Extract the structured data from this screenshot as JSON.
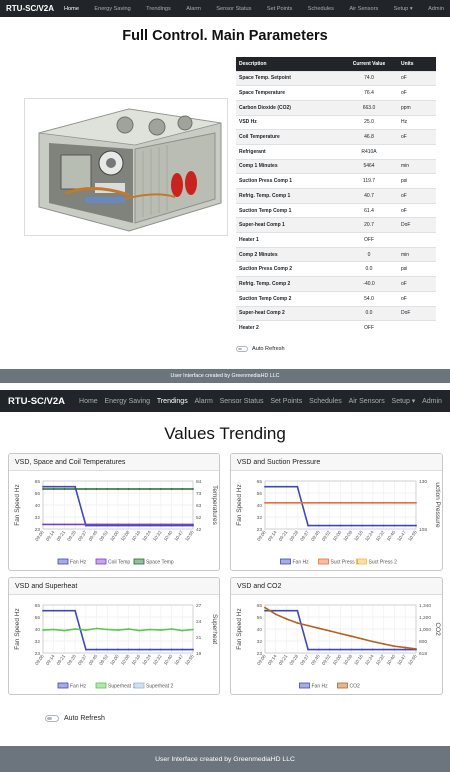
{
  "brand": "RTU-SC/V2A",
  "nav": [
    {
      "label": "Home"
    },
    {
      "label": "Energy Saving"
    },
    {
      "label": "Trendings"
    },
    {
      "label": "Alarm"
    },
    {
      "label": "Sensor Status"
    },
    {
      "label": "Set Points"
    },
    {
      "label": "Schedules"
    },
    {
      "label": "Air Sensors"
    },
    {
      "label": "Setup ▾"
    },
    {
      "label": "Admin"
    }
  ],
  "page1": {
    "title": "Full Control. Main Parameters",
    "table_headers": [
      "Description",
      "Current Value",
      "Units"
    ],
    "rows": [
      [
        "Space Temp. Setpoint",
        "74.0",
        "oF"
      ],
      [
        "Space Temperature",
        "76.4",
        "oF"
      ],
      [
        "Carbon Dioxide (CO2)",
        "663.0",
        "ppm"
      ],
      [
        "VSD Hz",
        "25.0",
        "Hz"
      ],
      [
        "Coil Temperature",
        "46.8",
        "oF"
      ],
      [
        "Refrigerant",
        "R410A",
        ""
      ],
      [
        "Comp 1 Minutes",
        "5464",
        "min"
      ],
      [
        "Suction Press Comp 1",
        "119.7",
        "psi"
      ],
      [
        "Refrig. Temp. Comp 1",
        "40.7",
        "oF"
      ],
      [
        "Suction Temp Comp 1",
        "61.4",
        "oF"
      ],
      [
        "Super-heat Comp 1",
        "20.7",
        "DoF"
      ],
      [
        "Heater 1",
        "OFF",
        ""
      ],
      [
        "Comp 2 Minutes",
        "0",
        "min"
      ],
      [
        "Suction Press Comp 2",
        "0.0",
        "psi"
      ],
      [
        "Refrig. Temp. Comp 2",
        "-40.0",
        "oF"
      ],
      [
        "Suction Temp Comp 2",
        "54.0",
        "oF"
      ],
      [
        "Super-heat Comp 2",
        "0.0",
        "DoF"
      ],
      [
        "Heater 2",
        "OFF",
        ""
      ]
    ],
    "auto_refresh": "Auto Refresh",
    "footer": "User Interface created by GreenmediaHD LLC"
  },
  "page2": {
    "title": "Values Trending",
    "auto_refresh": "Auto Refresh",
    "footer": "User Interface created by GreenmediaHD LLC"
  },
  "colors": {
    "fan": "#3f48b9",
    "coil": "#7a3fc8",
    "space": "#1f6b2f",
    "suct1": "#ef6e35",
    "suct2": "#f5b942",
    "sh1": "#58c74d",
    "sh2": "#9ab8d9",
    "co2": "#b4621c"
  },
  "chart_data": [
    {
      "type": "line",
      "title": "VSD, Space and Coil Temperatures",
      "ylabel": "Fan Speed Hz",
      "y2label": "Temperatures",
      "x": [
        "09:06",
        "09:14",
        "09:21",
        "09:28",
        "09:37",
        "09:45",
        "09:52",
        "10:00",
        "10:08",
        "10:16",
        "10:24",
        "10:32",
        "10:40",
        "10:47",
        "10:55"
      ],
      "yticks": [
        "65",
        "56",
        "40",
        "32",
        "23"
      ],
      "y2ticks": [
        "84",
        "73",
        "63",
        "52",
        "42"
      ],
      "ylim": [
        23,
        65
      ],
      "y2lim": [
        42,
        84
      ],
      "series": [
        {
          "name": "Fan Hz",
          "axis": "left",
          "color": "#3f48b9",
          "values": [
            60,
            60,
            60,
            60,
            26,
            26,
            26,
            26,
            26,
            26,
            26,
            26,
            26,
            26,
            26
          ]
        },
        {
          "name": "Coil Temp",
          "axis": "right",
          "color": "#7a3fc8",
          "values": [
            46,
            46,
            46,
            46,
            46,
            46,
            46,
            46,
            46,
            46,
            46,
            46,
            46,
            46,
            46
          ]
        },
        {
          "name": "Space Temp",
          "axis": "right",
          "color": "#1f6b2f",
          "values": [
            77,
            77,
            77,
            77,
            77,
            77,
            77,
            77,
            77,
            77,
            77,
            77,
            77,
            77,
            77
          ]
        }
      ]
    },
    {
      "type": "line",
      "title": "VSD and Suction Pressure",
      "ylabel": "Fan Speed Hz",
      "y2label": "uction Pressure",
      "x": [
        "09:06",
        "09:14",
        "09:21",
        "09:28",
        "09:37",
        "09:45",
        "09:52",
        "10:00",
        "10:08",
        "10:16",
        "10:24",
        "10:32",
        "10:40",
        "10:47",
        "10:55"
      ],
      "yticks": [
        "65",
        "56",
        "40",
        "32",
        "23"
      ],
      "y2ticks": [
        "130",
        "",
        "",
        "",
        "108"
      ],
      "ylim": [
        23,
        65
      ],
      "y2lim": [
        108,
        130
      ],
      "series": [
        {
          "name": "Fan Hz",
          "axis": "left",
          "color": "#3f48b9",
          "values": [
            60,
            60,
            60,
            60,
            26,
            26,
            26,
            26,
            26,
            26,
            26,
            26,
            26,
            26,
            26
          ]
        },
        {
          "name": "Suct Press 1",
          "axis": "right",
          "color": "#ef6e35",
          "values": [
            120,
            120,
            120,
            120,
            120,
            120,
            120,
            120,
            120,
            120,
            120,
            120,
            120,
            120,
            120
          ]
        },
        {
          "name": "Suct Press 2",
          "axis": "right",
          "color": "#f5b942",
          "values": []
        }
      ]
    },
    {
      "type": "line",
      "title": "VSD and Superheat",
      "ylabel": "Fan Speed Hz",
      "y2label": "Superheat",
      "x": [
        "09:06",
        "09:14",
        "09:21",
        "09:28",
        "09:37",
        "09:45",
        "09:52",
        "10:00",
        "10:08",
        "10:16",
        "10:24",
        "10:32",
        "10:40",
        "10:47",
        "10:55"
      ],
      "yticks": [
        "65",
        "56",
        "40",
        "32",
        "23"
      ],
      "y2ticks": [
        "27",
        "24",
        "21",
        "19"
      ],
      "ylim": [
        23,
        65
      ],
      "y2lim": [
        18,
        27
      ],
      "series": [
        {
          "name": "Fan Hz",
          "axis": "left",
          "color": "#3f48b9",
          "values": [
            60,
            60,
            60,
            60,
            26,
            26,
            26,
            26,
            26,
            26,
            26,
            26,
            26,
            26,
            26
          ]
        },
        {
          "name": "Superheat 1",
          "axis": "right",
          "color": "#58c74d",
          "values": [
            22.3,
            22.4,
            22.2,
            22.5,
            22.3,
            22.6,
            22.4,
            22.3,
            22.5,
            22.2,
            22.4,
            22.3,
            22.5,
            22.2,
            22.4
          ]
        },
        {
          "name": "Superheat 2",
          "axis": "right",
          "color": "#9ab8d9",
          "values": []
        }
      ]
    },
    {
      "type": "line",
      "title": "VSD and CO2",
      "ylabel": "Fan Speed Hz",
      "y2label": "CO2",
      "x": [
        "09:06",
        "09:14",
        "09:21",
        "09:28",
        "09:37",
        "09:45",
        "09:52",
        "10:00",
        "10:08",
        "10:16",
        "10:24",
        "10:32",
        "10:40",
        "10:47",
        "10:55"
      ],
      "yticks": [
        "65",
        "56",
        "40",
        "32",
        "23"
      ],
      "y2ticks": [
        "1,340",
        "1,200",
        "1,000",
        "800",
        "618"
      ],
      "ylim": [
        23,
        65
      ],
      "y2lim": [
        618,
        1340
      ],
      "series": [
        {
          "name": "Fan Hz",
          "axis": "left",
          "color": "#3f48b9",
          "values": [
            60,
            60,
            60,
            60,
            26,
            26,
            26,
            26,
            26,
            26,
            26,
            26,
            26,
            26,
            26
          ]
        },
        {
          "name": "CO2",
          "axis": "right",
          "color": "#b4621c",
          "values": [
            1300,
            1200,
            1130,
            1070,
            1030,
            990,
            950,
            910,
            870,
            830,
            790,
            755,
            720,
            700,
            680
          ]
        }
      ]
    }
  ]
}
